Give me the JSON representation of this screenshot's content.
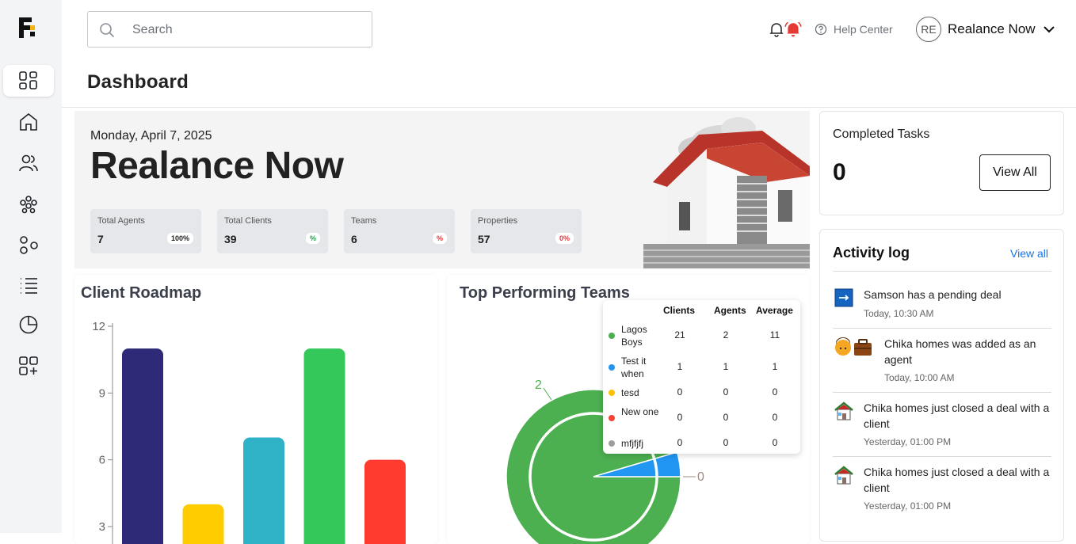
{
  "sidebar": {
    "logo_icon": "brand-logo-icon",
    "items": [
      {
        "icon": "dashboard-grid-icon",
        "active": true
      },
      {
        "icon": "home-icon",
        "active": false
      },
      {
        "icon": "users-icon",
        "active": false
      },
      {
        "icon": "teams-icon",
        "active": false
      },
      {
        "icon": "nodes-icon",
        "active": false
      },
      {
        "icon": "list-icon",
        "active": false
      },
      {
        "icon": "pie-chart-icon",
        "active": false
      },
      {
        "icon": "add-apps-icon",
        "active": false
      }
    ]
  },
  "header": {
    "search_placeholder": "Search",
    "help_label": "Help Center",
    "user_initials": "RE",
    "user_name": "Realance Now",
    "notification_color": "#e53935"
  },
  "page": {
    "title": "Dashboard"
  },
  "hero": {
    "date": "Monday, April 7, 2025",
    "name": "Realance Now",
    "stats": [
      {
        "label": "Total Agents",
        "value": "7",
        "badge": "100%",
        "badge_color": "#222222"
      },
      {
        "label": "Total Clients",
        "value": "39",
        "badge": "%",
        "badge_color": "#22a447"
      },
      {
        "label": "Teams",
        "value": "6",
        "badge": "%",
        "badge_color": "#e53935"
      },
      {
        "label": "Properties",
        "value": "57",
        "badge": "0%",
        "badge_color": "#e53935"
      }
    ]
  },
  "roadmap": {
    "title": "Client Roadmap"
  },
  "teams": {
    "title": "Top Performing Teams",
    "pie_label_outer": "2",
    "pie_label_small": "0",
    "table": {
      "headers": [
        "Clients",
        "Agents",
        "Average"
      ],
      "rows": [
        {
          "name": "Lagos Boys",
          "color": "#4caf50",
          "clients": "21",
          "agents": "2",
          "average": "11"
        },
        {
          "name": "Test it when",
          "color": "#2196f3",
          "clients": "1",
          "agents": "1",
          "average": "1"
        },
        {
          "name": "tesd",
          "color": "#ffc107",
          "clients": "0",
          "agents": "0",
          "average": "0"
        },
        {
          "name": "New one",
          "color": "#f44336",
          "clients": "0",
          "agents": "0",
          "average": "0"
        },
        {
          "name": "mfjfjfj",
          "color": "#9e9e9e",
          "clients": "0",
          "agents": "0",
          "average": "0"
        }
      ]
    }
  },
  "completed_tasks": {
    "title": "Completed Tasks",
    "value": "0",
    "button": "View All"
  },
  "activity": {
    "title": "Activity log",
    "view_all": "View all",
    "items": [
      {
        "icon": "arrow-box-icon",
        "text": "Samson has a pending deal",
        "time": "Today, 10:30 AM"
      },
      {
        "icon": "agent-briefcase-icon",
        "text": "Chika homes was added as an agent",
        "time": "Today, 10:00 AM"
      },
      {
        "icon": "house-icon",
        "text": "Chika homes just closed a deal with a client",
        "time": "Yesterday, 01:00 PM"
      },
      {
        "icon": "house-icon",
        "text": "Chika homes just closed a deal with a client",
        "time": "Yesterday, 01:00 PM"
      }
    ]
  },
  "chart_data": [
    {
      "type": "bar",
      "title": "Client Roadmap",
      "categories": [
        "",
        "",
        "",
        "",
        ""
      ],
      "values": [
        11,
        4,
        7,
        11,
        6
      ],
      "colors": [
        "#2e2a78",
        "#ffcc00",
        "#2fb1c6",
        "#34c759",
        "#ff3b30"
      ],
      "yticks": [
        "3",
        "6",
        "9",
        "12"
      ],
      "ylim": [
        3,
        12
      ],
      "grid": false
    },
    {
      "type": "pie",
      "title": "Top Performing Teams",
      "labels": [
        "Lagos Boys",
        "Test it when"
      ],
      "values": [
        21,
        1
      ],
      "colors": [
        "#4caf50",
        "#2196f3"
      ]
    }
  ]
}
